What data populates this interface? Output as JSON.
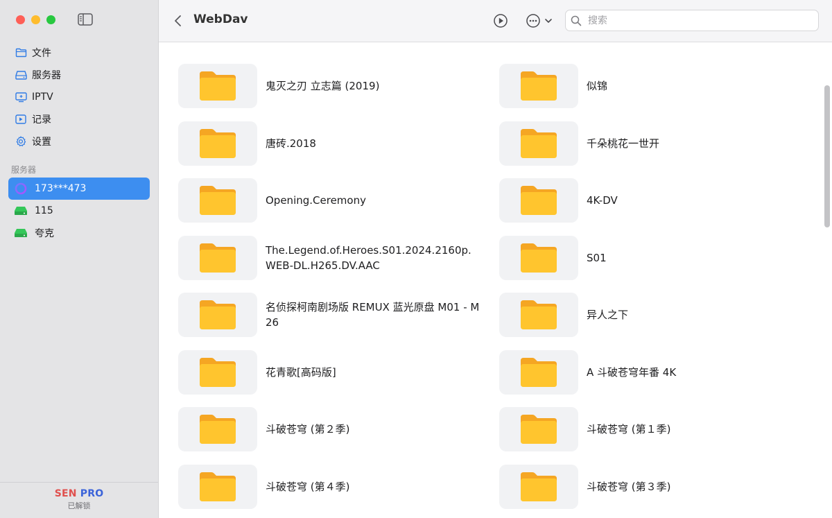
{
  "sidebar": {
    "nav": [
      {
        "label": "文件",
        "icon": "folder-icon"
      },
      {
        "label": "服务器",
        "icon": "server-icon"
      },
      {
        "label": "IPTV",
        "icon": "tv-icon"
      },
      {
        "label": "记录",
        "icon": "play-square-icon"
      },
      {
        "label": "设置",
        "icon": "gear-icon"
      }
    ],
    "section_title": "服务器",
    "servers": [
      {
        "label": "173***473",
        "icon": "webdav-ring-icon",
        "active": true
      },
      {
        "label": "115",
        "icon": "drive-icon",
        "active": false
      },
      {
        "label": "夸克",
        "icon": "drive-icon",
        "active": false
      }
    ],
    "footer": {
      "brand_a": "SEN",
      "brand_b": "PRO",
      "status": "已解锁"
    }
  },
  "toolbar": {
    "title": "WebDav",
    "search_placeholder": "搜索"
  },
  "folders": [
    "鬼灭之刃 立志篇 (2019)",
    "似锦",
    "唐砖.2018",
    "千朵桃花一世开",
    "Opening.Ceremony",
    "4K-DV",
    "The.Legend.of.Heroes.S01.2024.2160p.WEB-DL.H265.DV.AAC",
    "S01",
    "名侦探柯南剧场版 REMUX 蓝光原盘 M01 - M26",
    "异人之下",
    "花青歌[高码版]",
    "A 斗破苍穹年番 4K",
    "斗破苍穹 (第２季)",
    "斗破苍穹 (第１季)",
    "斗破苍穹 (第４季)",
    "斗破苍穹 (第３季)"
  ],
  "colors": {
    "accent": "#3d8ef0",
    "folder": "#ffc52e",
    "folder_tab": "#f5a623",
    "drive": "#34c759"
  }
}
